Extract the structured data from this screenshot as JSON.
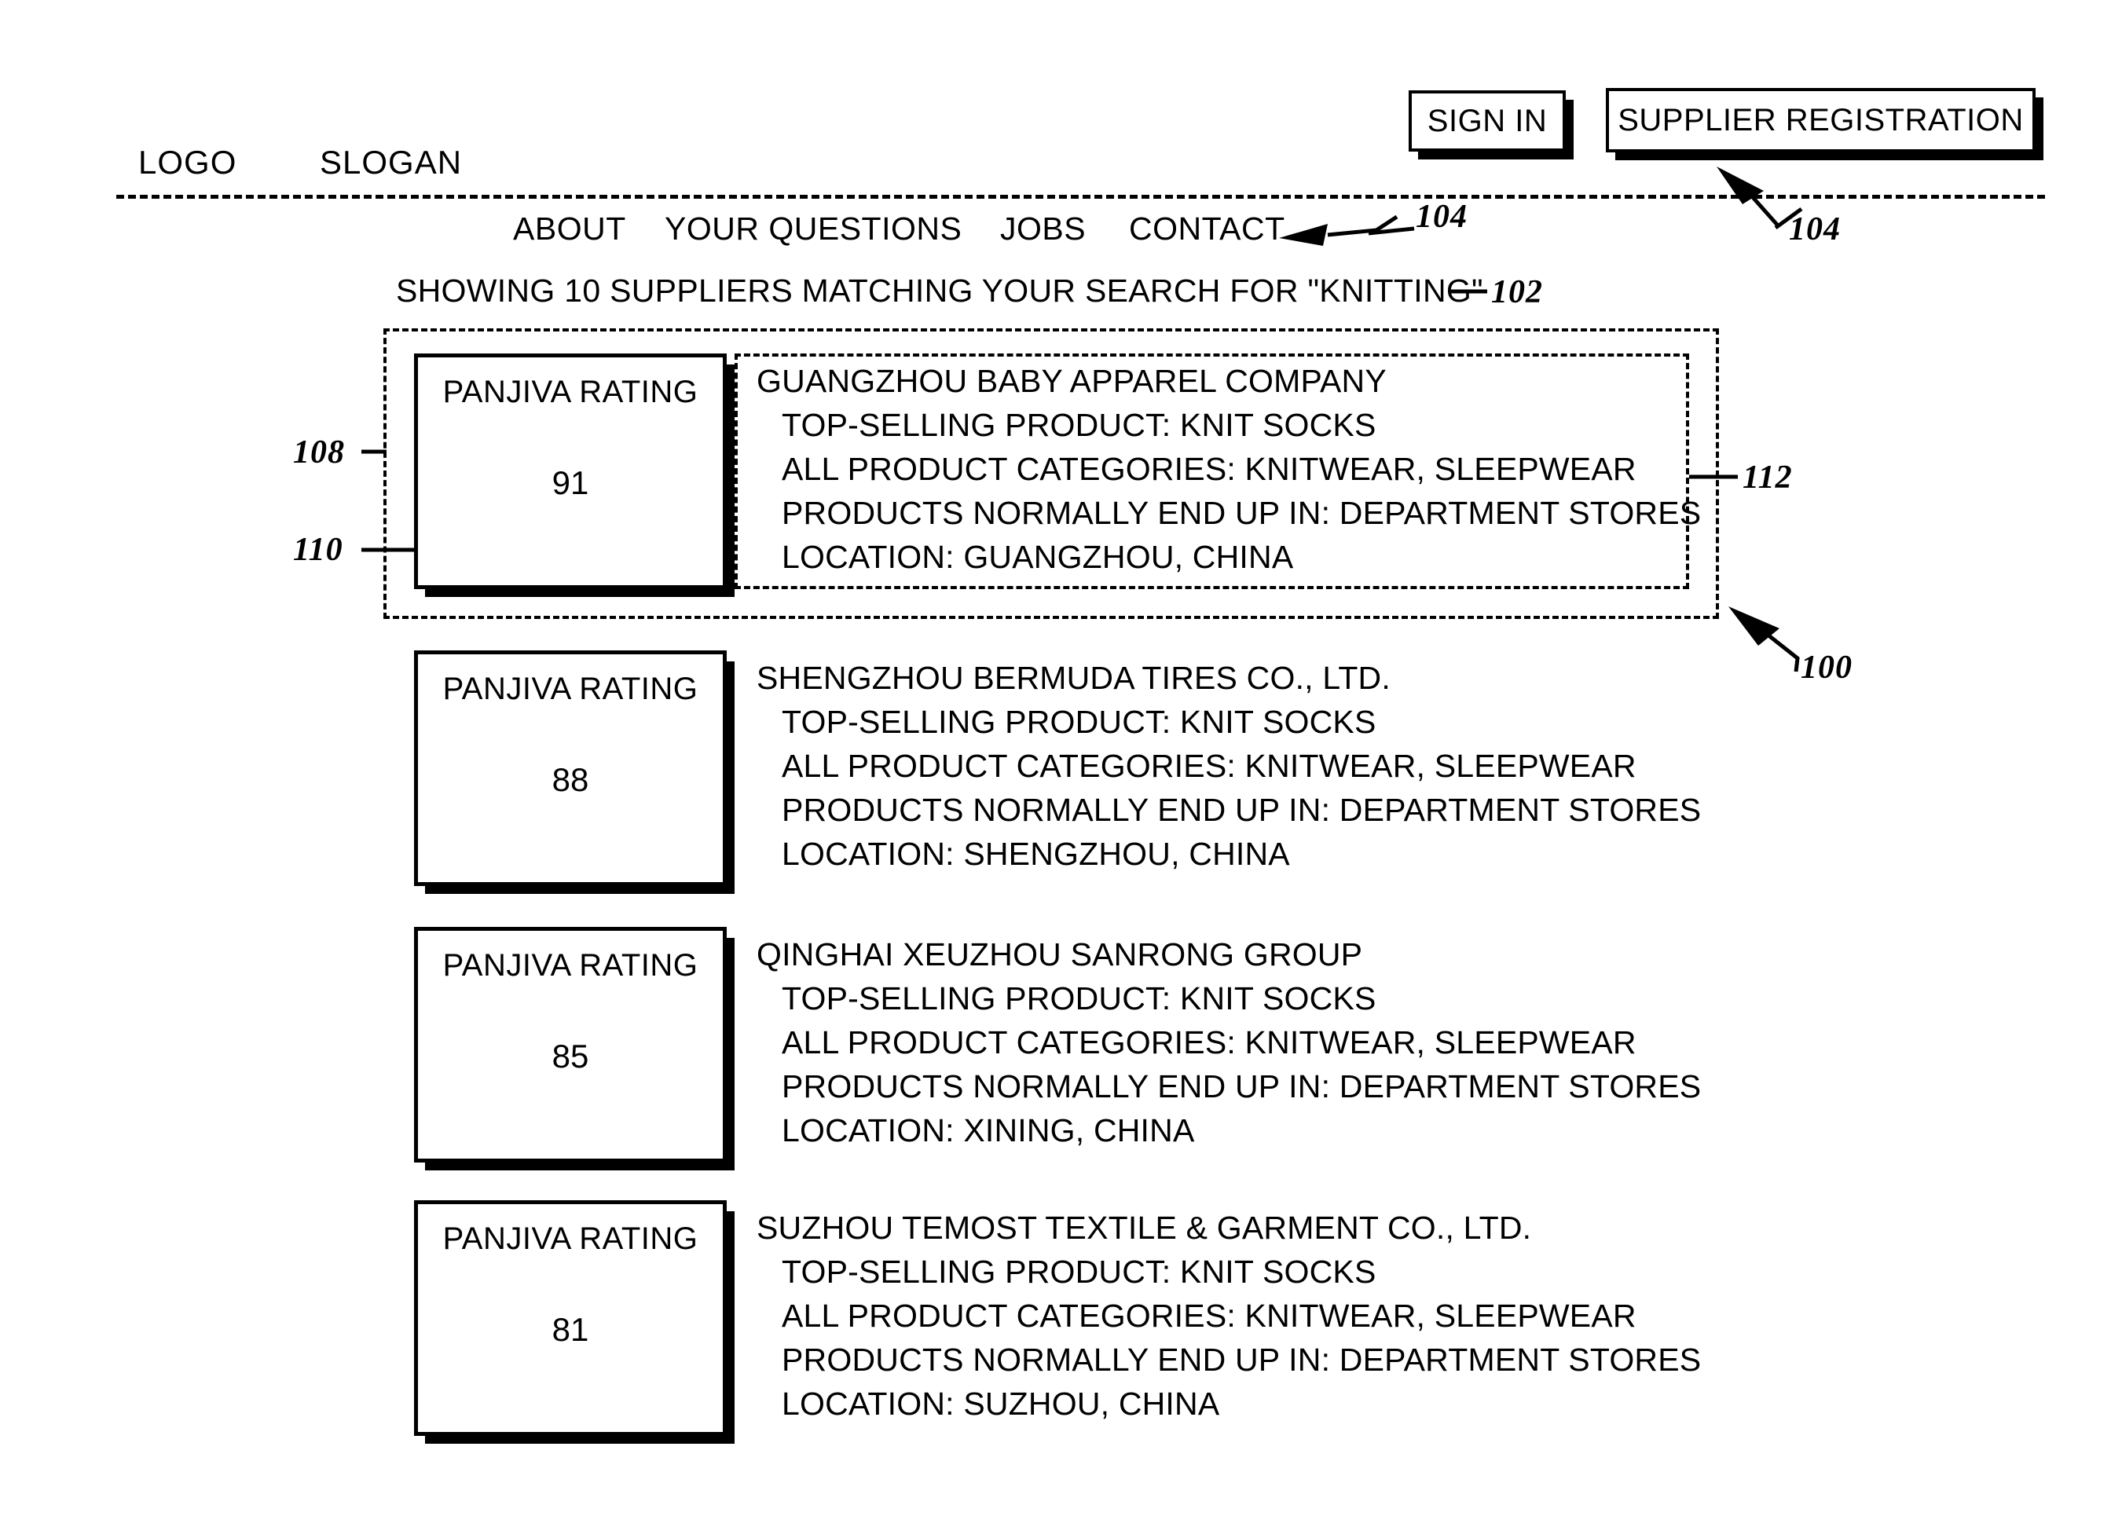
{
  "header": {
    "logo": "LOGO",
    "slogan": "SLOGAN",
    "sign_in_label": "SIGN IN",
    "supplier_registration_label": "SUPPLIER REGISTRATION"
  },
  "nav": {
    "items": [
      {
        "label": "ABOUT"
      },
      {
        "label": "YOUR QUESTIONS"
      },
      {
        "label": "JOBS"
      },
      {
        "label": "CONTACT"
      }
    ]
  },
  "results": {
    "summary": "SHOWING 10 SUPPLIERS MATCHING YOUR SEARCH FOR \"KNITTING\""
  },
  "suppliers": [
    {
      "rating_label": "PANJIVA RATING",
      "rating_value": "91",
      "company": "GUANGZHOU BABY APPAREL COMPANY",
      "top_selling": "TOP-SELLING PRODUCT: KNIT SOCKS",
      "categories": "ALL PRODUCT CATEGORIES: KNITWEAR, SLEEPWEAR",
      "end_up_in": "PRODUCTS NORMALLY END UP IN: DEPARTMENT STORES",
      "location": "LOCATION: GUANGZHOU, CHINA"
    },
    {
      "rating_label": "PANJIVA RATING",
      "rating_value": "88",
      "company": "SHENGZHOU BERMUDA TIRES CO., LTD.",
      "top_selling": "TOP-SELLING PRODUCT: KNIT SOCKS",
      "categories": "ALL PRODUCT CATEGORIES: KNITWEAR, SLEEPWEAR",
      "end_up_in": "PRODUCTS NORMALLY END UP IN: DEPARTMENT STORES",
      "location": "LOCATION: SHENGZHOU, CHINA"
    },
    {
      "rating_label": "PANJIVA RATING",
      "rating_value": "85",
      "company": "QINGHAI XEUZHOU SANRONG GROUP",
      "top_selling": "TOP-SELLING PRODUCT: KNIT SOCKS",
      "categories": "ALL PRODUCT CATEGORIES: KNITWEAR, SLEEPWEAR",
      "end_up_in": "PRODUCTS NORMALLY END UP IN: DEPARTMENT STORES",
      "location": "LOCATION: XINING, CHINA"
    },
    {
      "rating_label": "PANJIVA RATING",
      "rating_value": "81",
      "company": "SUZHOU TEMOST TEXTILE & GARMENT CO., LTD.",
      "top_selling": "TOP-SELLING PRODUCT: KNIT SOCKS",
      "categories": "ALL PRODUCT CATEGORIES: KNITWEAR, SLEEPWEAR",
      "end_up_in": "PRODUCTS NORMALLY END UP IN: DEPARTMENT STORES",
      "location": "LOCATION: SUZHOU, CHINA"
    }
  ],
  "reference_numerals": {
    "figure": "100",
    "results_summary": "102",
    "nav": "104",
    "nav_register": "104",
    "result_row": "108",
    "rating_box": "110",
    "detail_box": "112"
  }
}
